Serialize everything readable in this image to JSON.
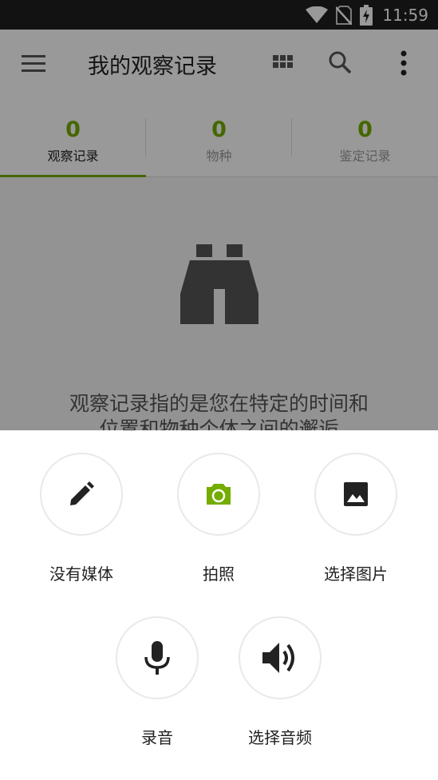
{
  "status_bar": {
    "time": "11:59",
    "icons": [
      "wifi-icon",
      "no-sim-icon",
      "battery-charging-icon"
    ]
  },
  "app_bar": {
    "title": "我的观察记录",
    "icons": [
      "menu-icon",
      "grid-view-icon",
      "search-icon",
      "more-vert-icon"
    ]
  },
  "tabs": [
    {
      "count": "0",
      "label": "观察记录",
      "active": true
    },
    {
      "count": "0",
      "label": "物种",
      "active": false
    },
    {
      "count": "0",
      "label": "鉴定记录",
      "active": false
    }
  ],
  "empty_state": {
    "icon": "binoculars-icon",
    "text_line1": "观察记录指的是您在特定的时间和",
    "text_line2": "位置和物种个体之间的邂逅"
  },
  "bottom_sheet": {
    "options": [
      {
        "label": "没有媒体",
        "icon": "pencil-icon"
      },
      {
        "label": "拍照",
        "icon": "camera-icon"
      },
      {
        "label": "选择图片",
        "icon": "image-icon"
      },
      {
        "label": "录音",
        "icon": "microphone-icon"
      },
      {
        "label": "选择音频",
        "icon": "volume-icon"
      }
    ]
  },
  "colors": {
    "accent": "#74ac00",
    "status_bar": "#1f1f1f",
    "scrim": "rgba(0,0,0,0.4)"
  }
}
